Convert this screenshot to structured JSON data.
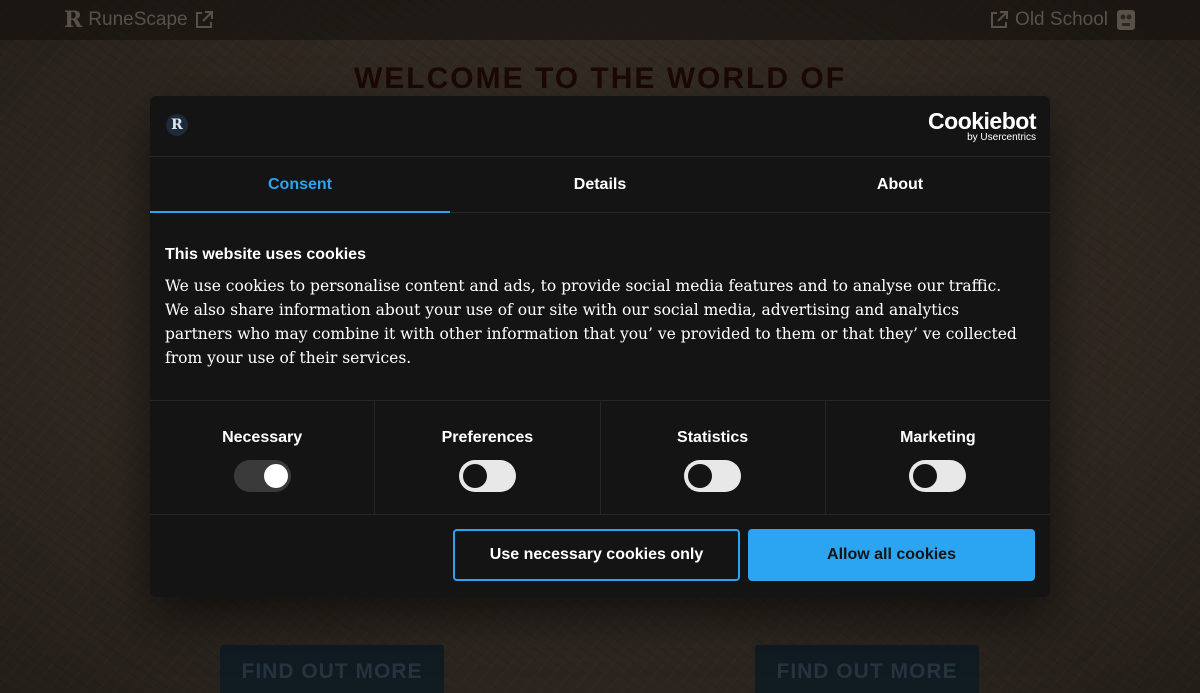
{
  "background": {
    "brand_left": "RuneScape",
    "brand_right": "Old School",
    "heading": "WELCOME TO THE WORLD OF",
    "find_out_left": "FIND OUT MORE",
    "find_out_right": "FIND OUT MORE",
    "icons": [
      "runescape-logo-icon",
      "external-link-icon",
      "old-school-quest-icon"
    ]
  },
  "dialog": {
    "brand_icon": "R",
    "provider": {
      "name": "Cookiebot",
      "sub": "by Usercentrics"
    },
    "tabs": [
      {
        "label": "Consent",
        "active": true
      },
      {
        "label": "Details",
        "active": false
      },
      {
        "label": "About",
        "active": false
      }
    ],
    "title": "This website uses cookies",
    "body": "We use cookies to personalise content and ads, to provide social media features and to analyse our traffic. We also share information about your use of our site with our social media, advertising and analytics partners who may combine it with other information that you’  ve provided to them or that they’  ve collected from your use of their services.",
    "categories": [
      {
        "label": "Necessary",
        "enabled": true
      },
      {
        "label": "Preferences",
        "enabled": false
      },
      {
        "label": "Statistics",
        "enabled": false
      },
      {
        "label": "Marketing",
        "enabled": false
      }
    ],
    "buttons": {
      "necessary_only": "Use necessary cookies only",
      "allow_all": "Allow all cookies"
    }
  },
  "colors": {
    "accent": "#2ba4f2",
    "dialog_bg": "#141414",
    "heading_red": "#2e0d08"
  }
}
